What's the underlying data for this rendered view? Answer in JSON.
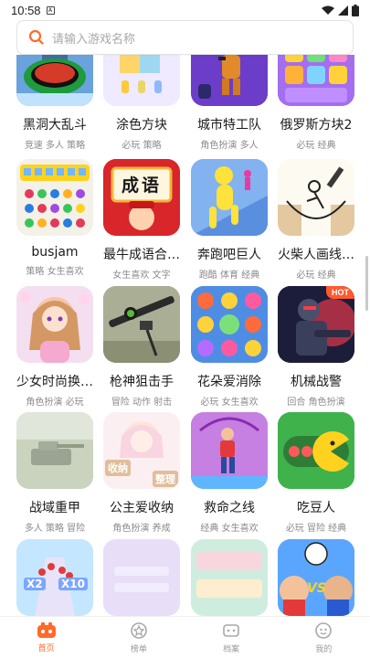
{
  "status_bar": {
    "time": "10:58",
    "sim_label": "A"
  },
  "search": {
    "placeholder": "请输入游戏名称"
  },
  "games": [
    {
      "title": "黑洞大乱斗",
      "tags": "竞速 多人 策略"
    },
    {
      "title": "涂色方块",
      "tags": "必玩 策略"
    },
    {
      "title": "城市特工队",
      "tags": "角色扮演 多人"
    },
    {
      "title": "俄罗斯方块2",
      "tags": "必玩 经典"
    },
    {
      "title": "busjam",
      "tags": "策略 女生喜欢"
    },
    {
      "title": "最牛成语合…",
      "tags": "女生喜欢 文字",
      "thumb_text": "成语"
    },
    {
      "title": "奔跑吧巨人",
      "tags": "跑酷 体育 经典"
    },
    {
      "title": "火柴人画线…",
      "tags": "必玩 经典"
    },
    {
      "title": "少女时尚换…",
      "tags": "角色扮演 必玩"
    },
    {
      "title": "枪神狙击手",
      "tags": "冒险 动作 射击"
    },
    {
      "title": "花朵爱消除",
      "tags": "必玩 女生喜欢"
    },
    {
      "title": "机械战警",
      "tags": "回合 角色扮演",
      "badge": "HOT"
    },
    {
      "title": "战域重甲",
      "tags": "多人 策略 冒险"
    },
    {
      "title": "公主爱收纳",
      "tags": "角色扮演 养成",
      "thumb_text_1": "收纳",
      "thumb_text_2": "整理"
    },
    {
      "title": "救命之线",
      "tags": "经典 女生喜欢"
    },
    {
      "title": "吃豆人",
      "tags": "必玩 冒险 经典"
    },
    {
      "title": "",
      "tags": "",
      "thumb_text_1": "X2",
      "thumb_text_2": "X10"
    },
    {
      "title": "",
      "tags": ""
    },
    {
      "title": "",
      "tags": ""
    },
    {
      "title": "",
      "tags": "",
      "thumb_text": "VS"
    }
  ],
  "tabbar": {
    "tabs": [
      {
        "label": "首页",
        "icon": "home-icon",
        "active": true
      },
      {
        "label": "榜单",
        "icon": "ranking-icon"
      },
      {
        "label": "档案",
        "icon": "archive-icon"
      },
      {
        "label": "我的",
        "icon": "profile-icon"
      }
    ]
  },
  "colors": {
    "accent": "#ff6a2b",
    "hot_badge": "#ff5a2d"
  }
}
